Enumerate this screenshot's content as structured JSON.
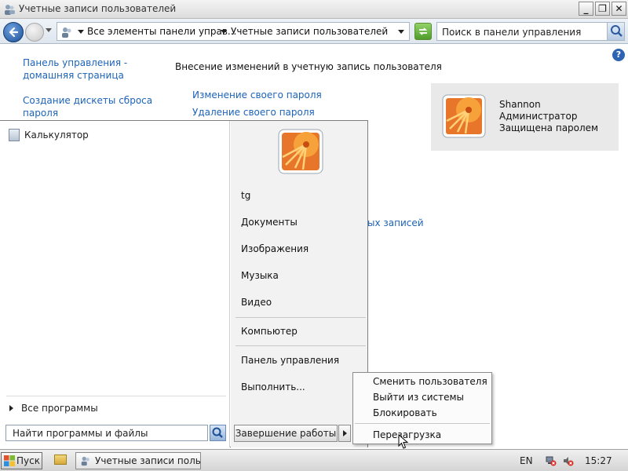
{
  "window": {
    "title": "Учетные записи пользователей",
    "controls": {
      "minimize": "_",
      "maximize": "❐",
      "close": "✕"
    }
  },
  "address_bar": {
    "breadcrumbs": [
      "Все элементы панели управ...",
      "Учетные записи пользователей"
    ],
    "search_placeholder": "Поиск в панели управления"
  },
  "control_panel": {
    "help_label": "?",
    "sidebar": [
      {
        "lines": [
          "Панель управления -",
          "домашняя страница"
        ]
      },
      {
        "lines": [
          "Создание дискеты сброса",
          "пароля"
        ]
      }
    ],
    "task_title": "Внесение изменений в учетную запись пользователя",
    "tasks": [
      "Изменение своего пароля",
      "Удаление своего пароля"
    ],
    "partial_link": "ых записей",
    "user": {
      "name": "Shannon",
      "role": "Администратор",
      "status": "Защищена паролем"
    }
  },
  "start_menu": {
    "pinned": [
      {
        "label": "Калькулятор",
        "icon": "calculator-icon"
      }
    ],
    "all_programs": "Все программы",
    "search_placeholder": "Найти программы и файлы",
    "user_name": "tg",
    "right_items": [
      "Документы",
      "Изображения",
      "Музыка",
      "Видео"
    ],
    "computer": "Компьютер",
    "right_items_2": [
      "Панель управления",
      "Выполнить..."
    ],
    "shutdown_label": "Завершение работы"
  },
  "power_menu": {
    "items": [
      "Сменить пользователя",
      "Выйти из системы",
      "Блокировать"
    ],
    "restart": "Перезагрузка"
  },
  "taskbar": {
    "start_label": "Пуск",
    "window_button": "Учетные записи польз...",
    "language": "EN",
    "clock": "15:27"
  }
}
